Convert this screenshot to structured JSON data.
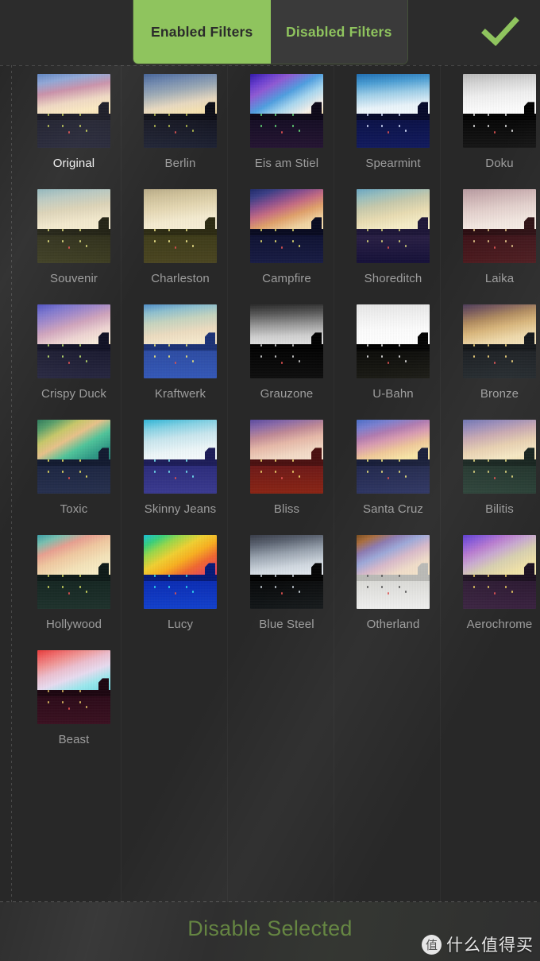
{
  "header": {
    "tabs": [
      {
        "label": "Enabled Filters",
        "active": true
      },
      {
        "label": "Disabled Filters",
        "active": false
      }
    ],
    "confirm_icon": "checkmark-icon",
    "accent_color": "#8fc45e"
  },
  "footer": {
    "action_label": "Disable Selected",
    "action_color": "#7aa64a",
    "watermark_logo": "值",
    "watermark_text": "什么值得买"
  },
  "grid": {
    "columns": 5,
    "items": [
      {
        "name": "Original",
        "selected": true,
        "sky": "linear-gradient(170deg,#5f86c4 0%,#8fa6d6 18%,#c98fa8 38%,#f0d9c2 62%,#fbe9c0 80%,#f5dca8 100%)",
        "ground": "linear-gradient(to bottom,#1c1d2b,#232436)",
        "skyline": "#14141f",
        "light": "#c9d257"
      },
      {
        "name": "Berlin",
        "selected": false,
        "sky": "linear-gradient(170deg,#3f5f96 0%,#6e87ad 20%,#9aa8b4 40%,#e8d9bf 66%,#f7e3b0 84%,#efd79c 100%)",
        "ground": "linear-gradient(to bottom,#11121d,#1d2133)",
        "skyline": "#0b0c14",
        "light": "#b9c24d"
      },
      {
        "name": "Eis am Stiel",
        "selected": false,
        "sky": "linear-gradient(150deg,#3018a8 0%,#6a3fd0 16%,#8f5ad4 28%,#4f9fe0 48%,#a9d7ef 64%,#f5f0ea 82%,#f0d79e 100%)",
        "ground": "linear-gradient(to bottom,#130c22,#241432)",
        "skyline": "#0d0818",
        "light": "#66e07a"
      },
      {
        "name": "Spearmint",
        "selected": false,
        "sky": "linear-gradient(175deg,#1e6fb5 0%,#4d9fd4 22%,#9fcfe8 45%,#e9f4fa 72%,#f6fbfd 100%)",
        "ground": "linear-gradient(to bottom,#0a1044,#111a5e)",
        "skyline": "#060a2a",
        "light": "#d7e2ff"
      },
      {
        "name": "Doku",
        "selected": false,
        "sky": "linear-gradient(175deg,#b9b9b9 0%,#d6d6d6 22%,#efefef 48%,#fafafa 75%,#ffffff 100%)",
        "ground": "linear-gradient(to bottom,#050505,#151515)",
        "skyline": "#000000",
        "light": "#e8e8e8"
      },
      {
        "name": "Souvenir",
        "selected": false,
        "sky": "linear-gradient(172deg,#8fb6bc 0%,#b9c8c0 20%,#dcd3b6 46%,#f2e8cb 72%,#f7efd2 100%)",
        "ground": "linear-gradient(to bottom,#2a2a16,#3a3a1e)",
        "skyline": "#1e1e10",
        "light": "#e2e07a"
      },
      {
        "name": "Charleston",
        "selected": false,
        "sky": "linear-gradient(172deg,#b8ab86 0%,#cfc19a 18%,#e4d7b2 42%,#f4ebd0 68%,#f8f0d8 100%)",
        "ground": "linear-gradient(to bottom,#3c3a18,#4a4520)",
        "skyline": "#2c2a12",
        "light": "#f0e68a"
      },
      {
        "name": "Campfire",
        "selected": false,
        "sky": "linear-gradient(160deg,#1e2a6a 0%,#3c3f86 14%,#8a4f8e 30%,#c56c82 44%,#e0a06a 60%,#f0d2a0 78%,#f7e6b8 100%)",
        "ground": "linear-gradient(to bottom,#0d1030,#181c44)",
        "skyline": "#080a20",
        "light": "#e8e070"
      },
      {
        "name": "Shoreditch",
        "selected": false,
        "sky": "linear-gradient(168deg,#6aa8c4 0%,#9cbfbc 18%,#c7c9ac 36%,#e8dcb2 58%,#f5ecc6 78%,#f8f0cf 100%)",
        "ground": "linear-gradient(to bottom,#2b2146,#151038)",
        "skyline": "#1d1638",
        "light": "#d8d47a"
      },
      {
        "name": "Laika",
        "selected": false,
        "sky": "linear-gradient(172deg,#b79aa0 0%,#cdb3b4 20%,#e3d0cc 45%,#f2e6e0 72%,#f7efe8 100%)",
        "ground": "linear-gradient(to bottom,#3a1016,#4a181c)",
        "skyline": "#2a0c10",
        "light": "#e6c888"
      },
      {
        "name": "Crispy Duck",
        "selected": false,
        "sky": "linear-gradient(162deg,#4c4ec0 0%,#7a74ce 16%,#a58ac8 32%,#d0a4bc 48%,#eed4d2 68%,#f8ecdd 86%,#f4dcae 100%)",
        "ground": "linear-gradient(to bottom,#19192e,#262640)",
        "skyline": "#101024",
        "light": "#b8dc6a"
      },
      {
        "name": "Kraftwerk",
        "selected": false,
        "sky": "linear-gradient(172deg,#4f8fc9 0%,#8fc0ce 18%,#c6d4bf 38%,#ecdcc0 62%,#f6e9cd 84%,#f4e2bd 100%)",
        "ground": "linear-gradient(to bottom,#2c4aa0,#3458b8)",
        "skyline": "#1c3276",
        "light": "#e8e27c"
      },
      {
        "name": "Grauzone",
        "selected": false,
        "sky": "linear-gradient(178deg,#2a2a2a 0%,#585858 22%,#9a9a9a 48%,#cfcfcf 72%,#e8e8e8 100%)",
        "ground": "linear-gradient(to bottom,#020202,#0e0e0e)",
        "skyline": "#000000",
        "light": "#cccccc"
      },
      {
        "name": "U-Bahn",
        "selected": false,
        "sky": "linear-gradient(178deg,#e6e6e6 0%,#f2f2f2 30%,#fcfcfc 60%,#ffffff 100%)",
        "ground": "linear-gradient(to bottom,#0a0a08,#1a1a14)",
        "skyline": "#000000",
        "light": "#dddddd"
      },
      {
        "name": "Bronze",
        "selected": false,
        "sky": "linear-gradient(168deg,#4a3a58 0%,#7a5a5a 16%,#b08a5c 34%,#d8b478 52%,#eed8a8 74%,#f6e8c4 100%)",
        "ground": "linear-gradient(to bottom,#15181c,#20262a)",
        "skyline": "#0c0f12",
        "light": "#f0d278"
      },
      {
        "name": "Toxic",
        "selected": false,
        "sky": "linear-gradient(150deg,#2c7a5c 0%,#5aa06a 14%,#c8c86a 30%,#e8c28a 44%,#4fc49a 62%,#2f9a86 80%,#2a7a72 100%)",
        "ground": "linear-gradient(to bottom,#1b2440,#26304e)",
        "skyline": "#121a30",
        "light": "#e8e060"
      },
      {
        "name": "Skinny Jeans",
        "selected": false,
        "sky": "linear-gradient(172deg,#2fb6d8 0%,#86d2e4 20%,#c8e6ee 42%,#ecf6f8 68%,#fbfdfe 100%)",
        "ground": "linear-gradient(to bottom,#2a2a78,#3a3a90)",
        "skyline": "#1c1c58",
        "light": "#6fe0f0"
      },
      {
        "name": "Bliss",
        "selected": false,
        "sky": "linear-gradient(168deg,#5a4aa0 0%,#8a6aa8 16%,#c08a96 34%,#e6b8a8 52%,#f2d8c4 74%,#f8e8d6 100%)",
        "ground": "linear-gradient(to bottom,#6a1818,#8a2414)",
        "skyline": "#4a1010",
        "light": "#f0d46a"
      },
      {
        "name": "Santa Cruz",
        "selected": false,
        "sky": "linear-gradient(165deg,#4a6ec8 0%,#7a7fd0 16%,#b07ab0 32%,#d89ab0 46%,#f0c898 64%,#f9e6a6 82%,#f7e0a0 100%)",
        "ground": "linear-gradient(to bottom,#1e2448,#2a3260)",
        "skyline": "#141a36",
        "light": "#e8e078"
      },
      {
        "name": "Bilitis",
        "selected": false,
        "sky": "linear-gradient(168deg,#6b72b2 0%,#9b8cb8 18%,#c8a8b0 36%,#e8d0b0 58%,#f6e8c4 80%,#f4e2ae 100%)",
        "ground": "linear-gradient(to bottom,#1e3028,#294036)",
        "skyline": "#14211c",
        "light": "#ddd47a"
      },
      {
        "name": "Hollywood",
        "selected": false,
        "sky": "linear-gradient(158deg,#3aa0a8 0%,#7ac0b0 14%,#e8a090 30%,#f0c8a0 46%,#f4e2b8 66%,#f8eec8 86%,#f4e6b0 100%)",
        "ground": "linear-gradient(to bottom,#142420,#1e322c)",
        "skyline": "#0e1a18",
        "light": "#d8e060"
      },
      {
        "name": "Lucy",
        "selected": false,
        "sky": "linear-gradient(150deg,#18c0d8 0%,#3ad07a 14%,#9ad84a 26%,#f0d032 42%,#f8b020 56%,#f06830 72%,#ea4a5a 88%,#e0406a 100%)",
        "ground": "linear-gradient(to bottom,#0a2ab0,#1240cc)",
        "skyline": "#061a78",
        "light": "#30e0f0"
      },
      {
        "name": "Blue Steel",
        "selected": false,
        "sky": "linear-gradient(172deg,#383c48 0%,#5c6472 20%,#9aa4b0 44%,#d0d8e0 70%,#eef2f6 100%)",
        "ground": "linear-gradient(to bottom,#060708,#121618)",
        "skyline": "#000000",
        "light": "#cfd8e0"
      },
      {
        "name": "Otherland",
        "selected": false,
        "sky": "linear-gradient(155deg,#7a4a18 0%,#a86a3a 12%,#8a78b0 26%,#9aa6d8 40%,#d8b8c8 56%,#f0dcc8 74%,#f6e8c8 100%)",
        "ground": "linear-gradient(to bottom,#d8d8d4,#efefee)",
        "skyline": "#b8b8b4",
        "light": "#4a4a4a"
      },
      {
        "name": "Aerochrome",
        "selected": false,
        "sky": "linear-gradient(155deg,#5a3ad0 0%,#8a5ad8 14%,#b87ad0 28%,#c8a8d0 42%,#d8d0b0 58%,#f0e2a8 78%,#f6ecb8 100%)",
        "ground": "linear-gradient(to bottom,#2a1830,#3a2240)",
        "skyline": "#1c1020",
        "light": "#f0d060"
      },
      {
        "name": "Beast",
        "selected": false,
        "sky": "linear-gradient(160deg,#e83a3a 0%,#f06a6a 14%,#f09898 28%,#ecc0d0 42%,#e8dcf0 58%,#9ae8ee 76%,#6ad8e0 100%)",
        "ground": "linear-gradient(to bottom,#2a0a18,#3a1020)",
        "skyline": "#1c0610",
        "light": "#e0c060"
      }
    ]
  }
}
